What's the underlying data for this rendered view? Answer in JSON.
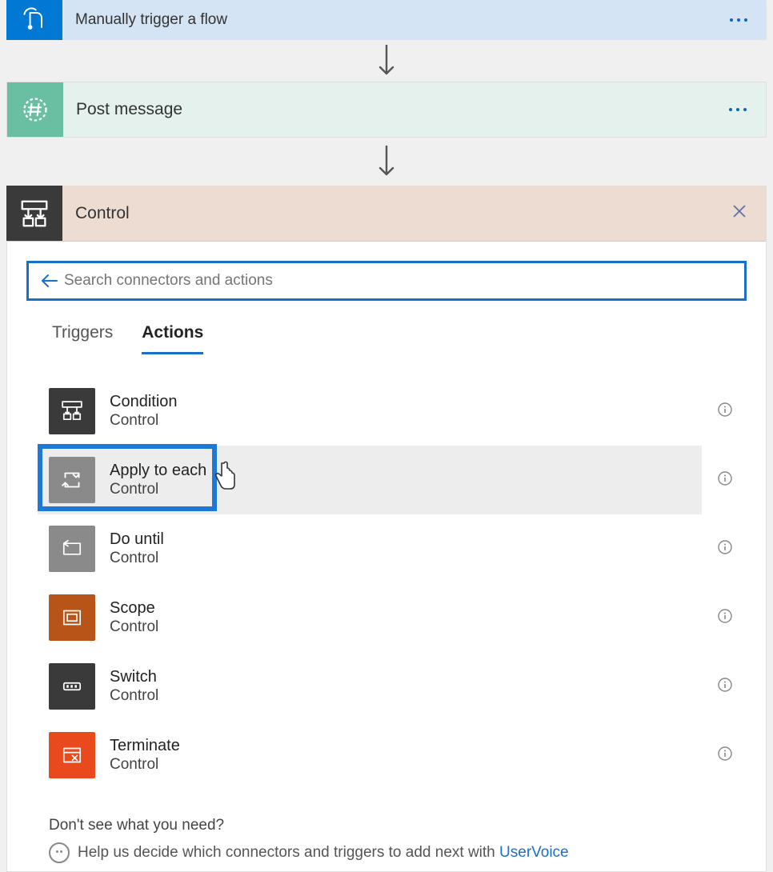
{
  "steps": {
    "trigger": {
      "title": "Manually trigger a flow"
    },
    "post": {
      "title": "Post message"
    },
    "control": {
      "title": "Control"
    }
  },
  "search": {
    "placeholder": "Search connectors and actions"
  },
  "tabs": {
    "triggers": "Triggers",
    "actions": "Actions"
  },
  "actions": [
    {
      "title": "Condition",
      "subtitle": "Control"
    },
    {
      "title": "Apply to each",
      "subtitle": "Control"
    },
    {
      "title": "Do until",
      "subtitle": "Control"
    },
    {
      "title": "Scope",
      "subtitle": "Control"
    },
    {
      "title": "Switch",
      "subtitle": "Control"
    },
    {
      "title": "Terminate",
      "subtitle": "Control"
    }
  ],
  "footer": {
    "line1": "Don't see what you need?",
    "line2_pre": "Help us decide which connectors and triggers to add next with ",
    "line2_link": "UserVoice"
  }
}
